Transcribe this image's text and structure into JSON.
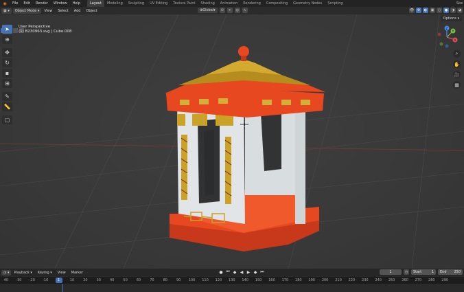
{
  "topbar": {
    "menus": [
      "File",
      "Edit",
      "Render",
      "Window",
      "Help"
    ],
    "workspaces": [
      "Layout",
      "Modeling",
      "Sculpting",
      "UV Editing",
      "Texture Paint",
      "Shading",
      "Animation",
      "Rendering",
      "Compositing",
      "Geometry Nodes",
      "Scripting"
    ],
    "active_workspace": "Layout",
    "scene": "Sce"
  },
  "header": {
    "mode": "Object Mode",
    "menus": [
      "View",
      "Select",
      "Add",
      "Object"
    ],
    "transform": "Global"
  },
  "viewport": {
    "perspective": "User Perspective",
    "object": "(1) B230963.svg | Cube.008",
    "options": "Options"
  },
  "gizmo": {
    "x": "X",
    "y": "Y",
    "z": "Z"
  },
  "timeline": {
    "menus": [
      "Playback",
      "Keying",
      "View",
      "Marker"
    ],
    "current_frame": "1",
    "start_label": "Start",
    "start": "1",
    "end_label": "End",
    "end": "250",
    "ruler": [
      "-40",
      "-30",
      "-20",
      "-10",
      "1",
      "10",
      "20",
      "30",
      "40",
      "50",
      "60",
      "70",
      "80",
      "90",
      "100",
      "110",
      "120",
      "130",
      "140",
      "150",
      "160",
      "170",
      "180",
      "190",
      "200",
      "210",
      "220",
      "230",
      "240",
      "250",
      "260",
      "270",
      "280",
      "290"
    ]
  },
  "colors": {
    "accent": "#4772b3",
    "brand": "#e87d0d",
    "pavilion_red": "#e8481f",
    "gold": "#c9a227",
    "wall": "#d8dde0"
  }
}
